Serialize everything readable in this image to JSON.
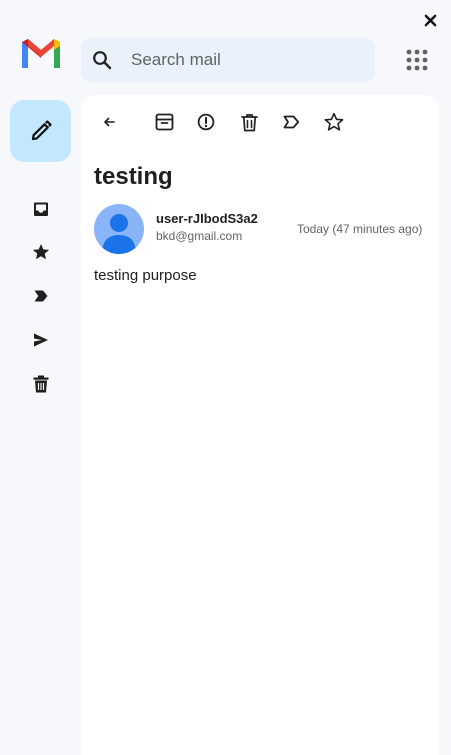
{
  "app": {
    "logo_icon": "gmail-logo",
    "close_icon": "close-icon",
    "apps_icon": "apps-grid-icon"
  },
  "search": {
    "placeholder": "Search mail",
    "value": "",
    "icon": "search-icon"
  },
  "sidebar": {
    "compose_icon": "pencil-icon",
    "items": [
      {
        "id": "inbox",
        "icon": "inbox-icon"
      },
      {
        "id": "starred",
        "icon": "star-icon"
      },
      {
        "id": "important",
        "icon": "label-icon"
      },
      {
        "id": "sent",
        "icon": "send-icon"
      },
      {
        "id": "trash",
        "icon": "trash-icon"
      }
    ]
  },
  "toolbar": {
    "items": [
      "back-icon",
      "archive-icon",
      "report-spam-icon",
      "delete-icon",
      "label-icon",
      "star-icon"
    ]
  },
  "email": {
    "subject": "testing",
    "sender_name": "user-rJIbodS3a2",
    "sender_email": "bkd@gmail.com",
    "date": "Today (47 minutes ago)",
    "body": "testing purpose"
  },
  "colors": {
    "page_bg": "#f6f8fc",
    "search_bg": "#eaf1fb",
    "compose_bg": "#c2e7ff",
    "avatar_bg": "#8ab4f8",
    "avatar_fg": "#1a73e8"
  }
}
